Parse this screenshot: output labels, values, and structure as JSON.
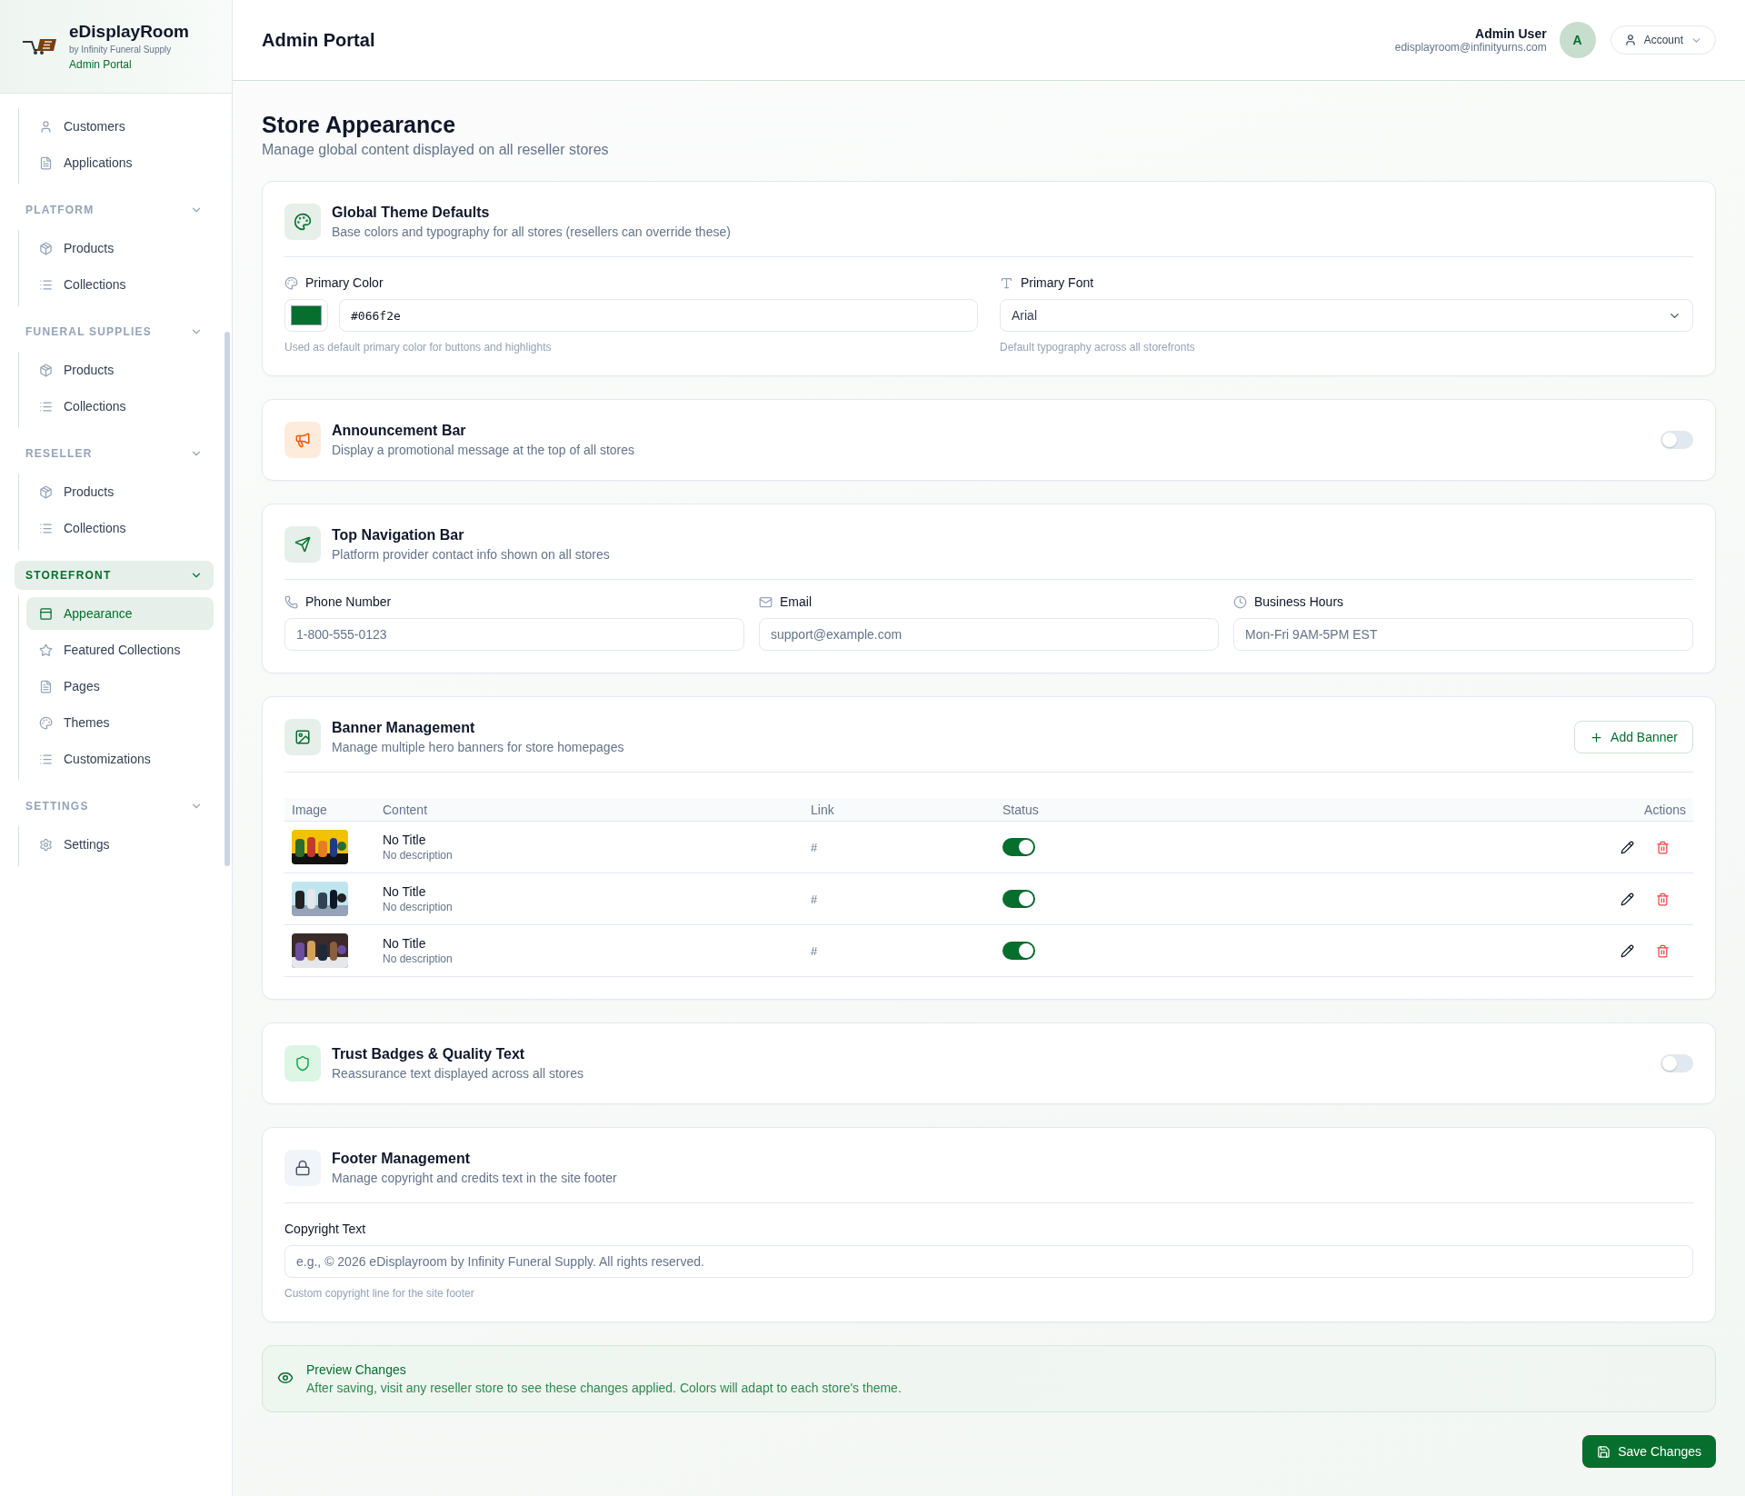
{
  "sidebar": {
    "brand": {
      "name": "eDisplayRoom",
      "tagline": "by Infinity Funeral Supply",
      "portal": "Admin Portal"
    },
    "top_items": [
      {
        "label": "Customers",
        "kind": "user",
        "selected": false
      },
      {
        "label": "Applications",
        "kind": "document",
        "selected": false
      }
    ],
    "sections": [
      {
        "title": "PLATFORM",
        "selected": false,
        "items": [
          {
            "label": "Products",
            "kind": "product",
            "selected": false
          },
          {
            "label": "Collections",
            "kind": "list",
            "selected": false
          }
        ]
      },
      {
        "title": "FUNERAL SUPPLIES",
        "selected": false,
        "items": [
          {
            "label": "Products",
            "kind": "product",
            "selected": false
          },
          {
            "label": "Collections",
            "kind": "list",
            "selected": false
          }
        ]
      },
      {
        "title": "RESELLER",
        "selected": false,
        "items": [
          {
            "label": "Products",
            "kind": "product",
            "selected": false
          },
          {
            "label": "Collections",
            "kind": "list",
            "selected": false
          }
        ]
      },
      {
        "title": "STOREFRONT",
        "selected": true,
        "items": [
          {
            "label": "Appearance",
            "kind": "layout",
            "selected": true
          },
          {
            "label": "Featured Collections",
            "kind": "star",
            "selected": false
          },
          {
            "label": "Pages",
            "kind": "document",
            "selected": false
          },
          {
            "label": "Themes",
            "kind": "palette",
            "selected": false
          },
          {
            "label": "Customizations",
            "kind": "list",
            "selected": false
          }
        ]
      },
      {
        "title": "SETTINGS",
        "selected": false,
        "items": [
          {
            "label": "Settings",
            "kind": "gear",
            "selected": false
          }
        ]
      }
    ]
  },
  "header": {
    "title": "Admin Portal",
    "user_name": "Admin User",
    "user_email": "edisplayroom@infinityurns.com",
    "avatar": "A",
    "account_button": "Account"
  },
  "page": {
    "title": "Store Appearance",
    "subtitle": "Manage global content displayed on all reseller stores"
  },
  "theme": {
    "title": "Global Theme Defaults",
    "description": "Base colors and typography for all stores (resellers can override these)",
    "color_label": "Primary Color",
    "color_value": "#066f2e",
    "color_hint": "Used as default primary color for buttons and highlights",
    "font_label": "Primary Font",
    "font_value": "Arial",
    "font_hint": "Default typography across all storefronts"
  },
  "announcement": {
    "title": "Announcement Bar",
    "description": "Display a promotional message at the top of all stores",
    "on": false
  },
  "top_nav": {
    "title": "Top Navigation Bar",
    "description": "Platform provider contact info shown on all stores",
    "fields": [
      {
        "label": "Phone Number",
        "kind": "phone",
        "placeholder": "1-800-555-0123"
      },
      {
        "label": "Email",
        "kind": "mail",
        "placeholder": "support@example.com"
      },
      {
        "label": "Business Hours",
        "kind": "clock",
        "placeholder": "Mon-Fri 9AM-5PM EST"
      }
    ]
  },
  "banners": {
    "title": "Banner Management",
    "description": "Manage multiple hero banners for store homepages",
    "add_button": "Add Banner",
    "columns": [
      "Image",
      "Content",
      "Link",
      "Status",
      "Actions"
    ],
    "rows": [
      {
        "title": "No Title",
        "description": "No description",
        "link": "#",
        "on": true
      },
      {
        "title": "No Title",
        "description": "No description",
        "link": "#",
        "on": true
      },
      {
        "title": "No Title",
        "description": "No description",
        "link": "#",
        "on": true
      }
    ]
  },
  "trust": {
    "title": "Trust Badges & Quality Text",
    "description": "Reassurance text displayed across all stores",
    "on": false
  },
  "footer": {
    "title": "Footer Management",
    "description": "Manage copyright and credits text in the site footer",
    "label": "Copyright Text",
    "placeholder": "e.g., © 2026 eDisplayroom by Infinity Funeral Supply. All rights reserved.",
    "hint": "Custom copyright line for the site footer"
  },
  "preview": {
    "title": "Preview Changes",
    "text": "After saving, visit any reseller store to see these changes applied. Colors will adapt to each store's theme."
  },
  "save_button": "Save Changes"
}
